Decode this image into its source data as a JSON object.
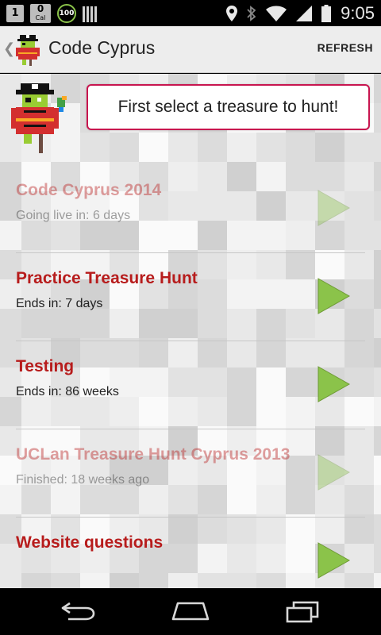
{
  "status_bar": {
    "notif_one": "1",
    "cal_number": "0",
    "cal_label": "Cal",
    "circle_badge": "100",
    "time": "9:05",
    "icons": [
      "sim-icon",
      "calendar-icon",
      "usage-circle-icon",
      "barcode-icon",
      "location-icon",
      "bluetooth-icon",
      "wifi-icon",
      "signal-icon",
      "battery-icon"
    ]
  },
  "action_bar": {
    "title": "Code Cyprus",
    "refresh_label": "REFRESH"
  },
  "header": {
    "prompt": "First select a treasure to hunt!"
  },
  "hunts": [
    {
      "title": "Code Cyprus 2014",
      "status": "Going live in: 6 days",
      "active": false
    },
    {
      "title": "Practice Treasure Hunt",
      "status": "Ends in: 7 days",
      "active": true
    },
    {
      "title": "Testing",
      "status": "Ends in: 86 weeks",
      "active": true
    },
    {
      "title": "UCLan Treasure Hunt Cyprus 2013",
      "status": "Finished: 18 weeks ago",
      "active": false
    },
    {
      "title": "Website questions",
      "status": "",
      "active": true
    }
  ],
  "colors": {
    "accent_red": "#b71c1c",
    "bubble_border": "#c8154f",
    "play_green": "#8bc34a"
  },
  "nav_bar": [
    "back-icon",
    "home-icon",
    "recent-apps-icon"
  ]
}
